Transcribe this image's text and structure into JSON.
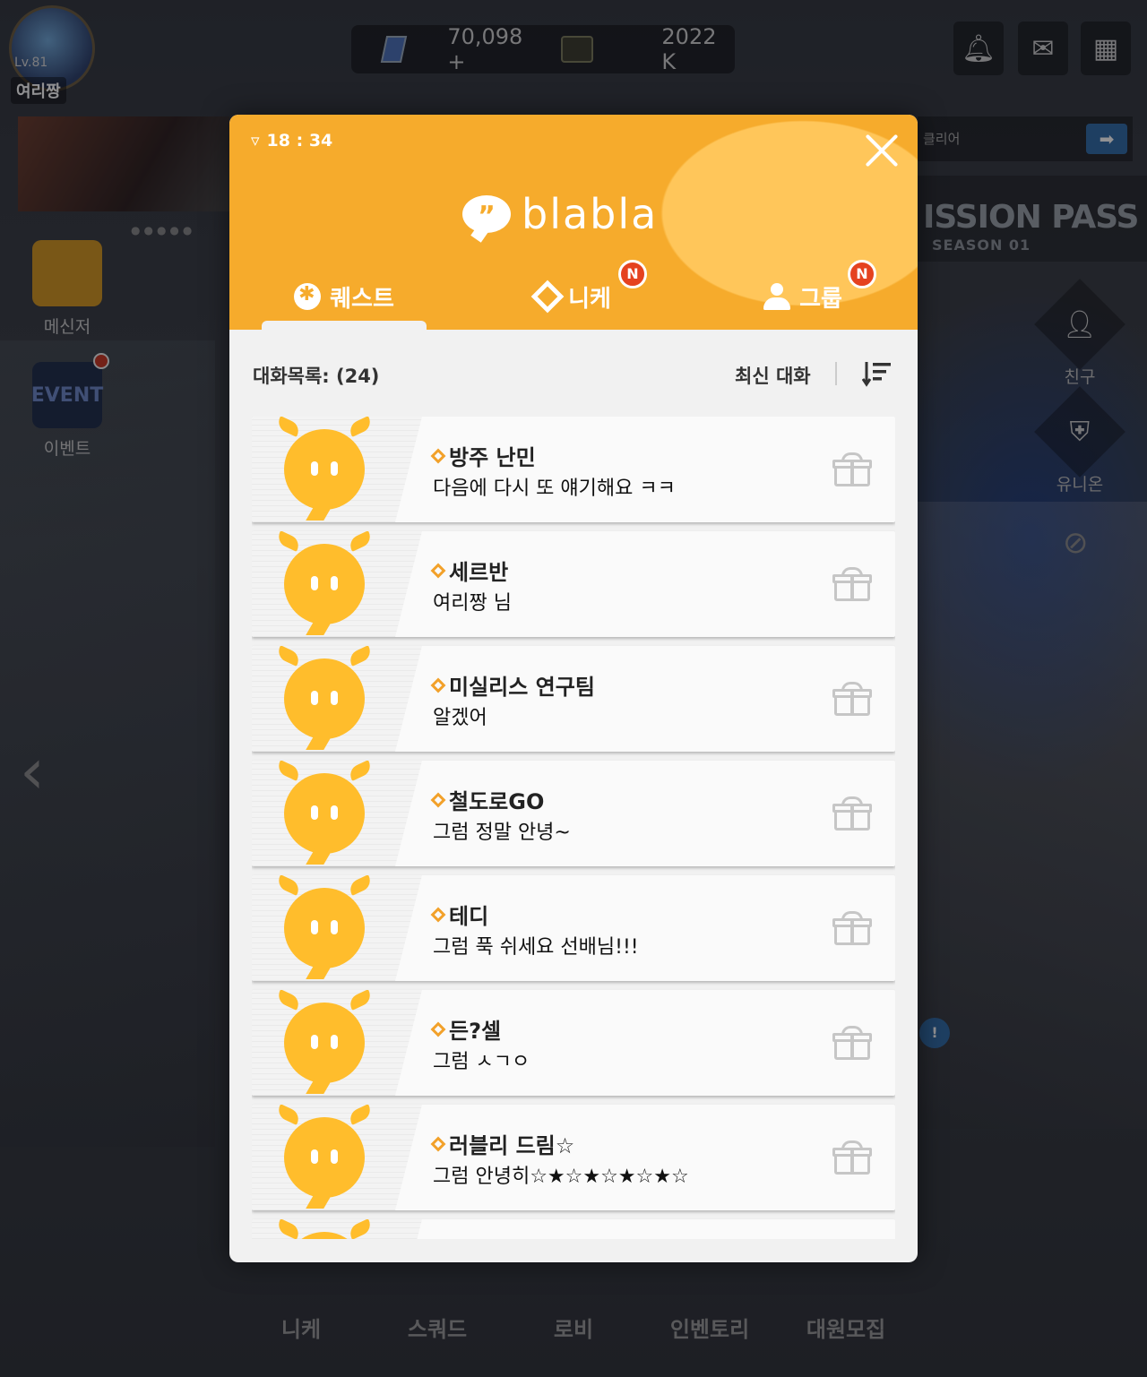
{
  "hud": {
    "level": "Lv.81",
    "username": "여리짱",
    "gems": "70,098",
    "gems_plus": "+",
    "credits": "2022 K",
    "icons": [
      "bell-icon",
      "mail-icon",
      "grid-menu-icon"
    ]
  },
  "left_menu": [
    {
      "label": "메신저",
      "icon": "messenger-icon"
    },
    {
      "label": "이벤트",
      "icon": "event-icon",
      "icon_text": "EVENT"
    }
  ],
  "right_menu": {
    "banner_text": "클리어",
    "mission_title": "ISSION PASS",
    "mission_season": "SEASON 01",
    "items": [
      {
        "label": "친구",
        "icon": "friend-icon"
      },
      {
        "label": "유니온",
        "icon": "union-shield-icon"
      }
    ]
  },
  "bottom_nav": [
    "니케",
    "스쿼드",
    "로비",
    "인벤토리",
    "대원모집"
  ],
  "modal": {
    "time": "18 : 34",
    "logo_text": "blabla",
    "logo_mark": "”",
    "tabs": [
      {
        "label": "퀘스트",
        "active": true,
        "badge": ""
      },
      {
        "label": "니케",
        "active": false,
        "badge": "N"
      },
      {
        "label": "그룹",
        "active": false,
        "badge": "N"
      }
    ],
    "list_count_label": "대화목록: (24)",
    "sort_label": "최신 대화",
    "conversations": [
      {
        "name": "방주 난민",
        "message": "다음에 다시 또 얘기해요 ㅋㅋ"
      },
      {
        "name": "세르반",
        "message": "여리짱 님"
      },
      {
        "name": "미실리스 연구팀",
        "message": "알겠어"
      },
      {
        "name": "철도로GO",
        "message": "그럼 정말 안녕~"
      },
      {
        "name": "테디",
        "message": "그럼 푹 쉬세요 선배님!!!"
      },
      {
        "name": "든?셀",
        "message": "그럼 ㅅㄱㅇ"
      },
      {
        "name": "러블리 드림☆",
        "message": "그럼 안녕히☆★☆★☆★☆★☆"
      }
    ],
    "colors": {
      "accent": "#f6ab2c",
      "badge": "#e5421f",
      "avatar": "#ffbd2c"
    }
  }
}
